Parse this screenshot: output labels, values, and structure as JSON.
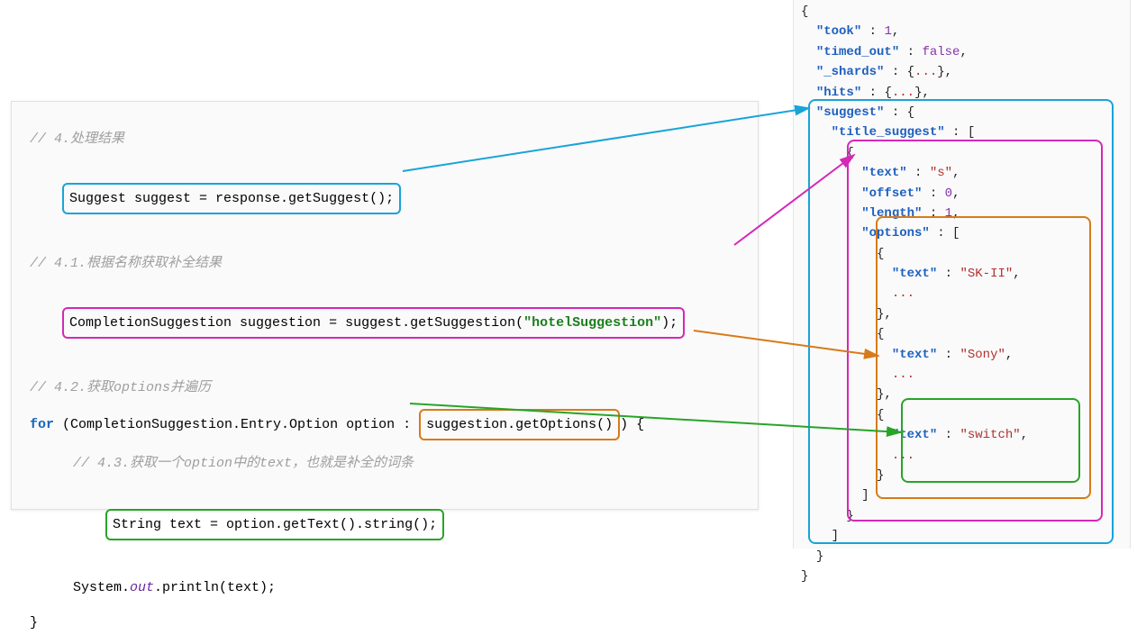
{
  "left": {
    "comment4": "// 4.处理结果",
    "line1": "Suggest suggest = response.getSuggest();",
    "comment41": "// 4.1.根据名称获取补全结果",
    "line2_pre": "CompletionSuggestion suggestion = suggest.getSuggestion(",
    "line2_str": "\"hotelSuggestion\"",
    "line2_post": ");",
    "comment42": "// 4.2.获取options并遍历",
    "for_kw": "for",
    "for_head_pre": " (CompletionSuggestion.Entry.Option option : ",
    "for_head_box": "suggestion.getOptions()",
    "for_head_post": ") {",
    "comment43": "// 4.3.获取一个option中的text，也就是补全的词条",
    "line3": "String text = option.getText().string();",
    "sys_pre": "System.",
    "sys_out": "out",
    "sys_post": ".println(text);",
    "close": "}"
  },
  "right": {
    "took_k": "\"took\"",
    "took_v": "1",
    "timed_k": "\"timed_out\"",
    "timed_v": "false",
    "shards_k": "\"_shards\"",
    "hits_k": "\"hits\"",
    "sugg_k": "\"suggest\"",
    "title_k": "\"title_suggest\"",
    "text_k": "\"text\"",
    "text_v": "\"s\"",
    "offset_k": "\"offset\"",
    "offset_v": "0",
    "length_k": "\"length\"",
    "length_v": "1",
    "options_k": "\"options\"",
    "opt1_v": "\"SK-II\"",
    "opt2_v": "\"Sony\"",
    "opt3_v": "\"switch\"",
    "dots": "..."
  }
}
